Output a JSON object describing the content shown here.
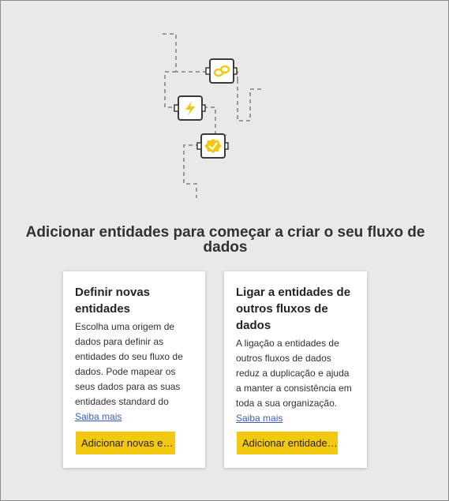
{
  "headline": "Adicionar entidades para começar a criar o seu fluxo de dados",
  "cards": [
    {
      "title": "Definir novas entidades",
      "description": "Escolha uma origem de dados para definir as entidades do seu fluxo de dados. Pode mapear os seus dados para as suas entidades standard do Common Data…",
      "link": "Saiba mais",
      "button": "Adicionar novas e…"
    },
    {
      "title": "Ligar a entidades de outros fluxos de dados",
      "description": "A ligação a entidades de outros fluxos de dados reduz a duplicação e ajuda a manter a consistência em toda a sua organização.",
      "link": "Saiba mais",
      "button": "Adicionar entidade…"
    }
  ],
  "icons": [
    "link-icon",
    "lightning-icon",
    "certified-badge-icon"
  ],
  "colors": {
    "background": "#e9e9e9",
    "accent": "#f2c811",
    "link": "#3e5db5",
    "card": "#ffffff",
    "text": "#323130"
  }
}
